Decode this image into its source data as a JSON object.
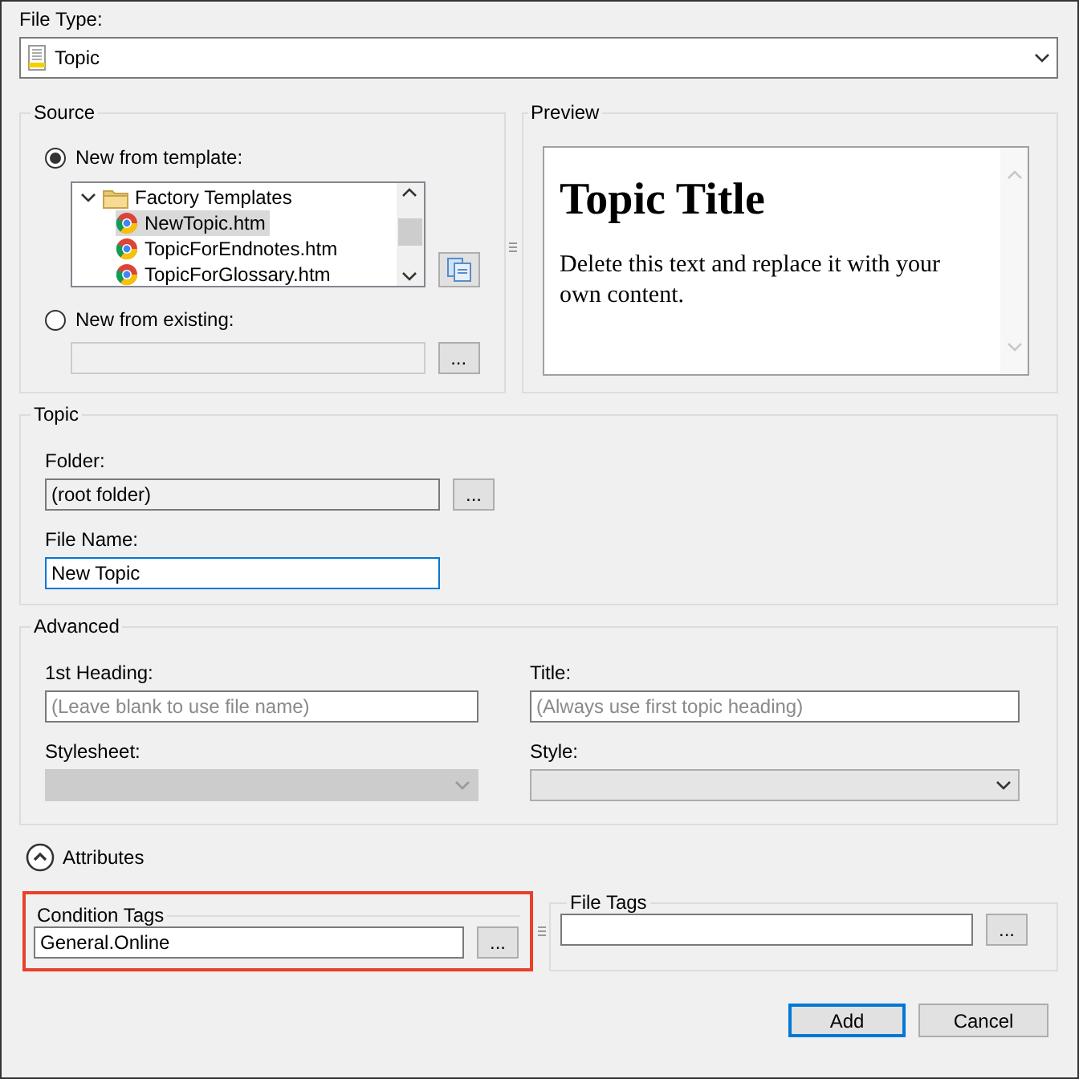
{
  "file_type": {
    "label": "File Type:",
    "value": "Topic"
  },
  "source": {
    "title": "Source",
    "options": [
      {
        "label": "New from template:",
        "selected": true
      },
      {
        "label": "New from existing:",
        "selected": false
      }
    ],
    "tree": [
      {
        "label": "Factory Templates",
        "kind": "folder",
        "expanded": true,
        "selected": false,
        "children": [
          {
            "label": "NewTopic.htm",
            "kind": "file",
            "selected": true
          },
          {
            "label": "TopicForEndnotes.htm",
            "kind": "file",
            "selected": false
          },
          {
            "label": "TopicForGlossary.htm",
            "kind": "file",
            "selected": false
          }
        ]
      }
    ],
    "existing_browse": "..."
  },
  "preview": {
    "title": "Preview",
    "heading": "Topic Title",
    "body": "Delete this text and replace it with your own content."
  },
  "topic": {
    "title": "Topic",
    "folder": {
      "label": "Folder:",
      "value": "(root folder)",
      "browse": "..."
    },
    "file_name": {
      "label": "File Name:",
      "value": "New Topic",
      "focused": true
    }
  },
  "advanced": {
    "title": "Advanced",
    "fields": [
      {
        "label": "1st Heading:",
        "kind": "text",
        "placeholder": "(Leave blank to use file name)"
      },
      {
        "label": "Title:",
        "kind": "text",
        "placeholder": "(Always use first topic heading)"
      },
      {
        "label": "Stylesheet:",
        "kind": "select",
        "disabled": true
      },
      {
        "label": "Style:",
        "kind": "select",
        "disabled": false
      }
    ]
  },
  "attributes": {
    "label": "Attributes",
    "expanded": true,
    "condition_tags": {
      "title": "Condition Tags",
      "value": "General.Online",
      "browse": "...",
      "highlighted": true
    },
    "file_tags": {
      "title": "File Tags",
      "browse": "..."
    }
  },
  "buttons": [
    {
      "label": "Add",
      "default": true
    },
    {
      "label": "Cancel",
      "default": false
    }
  ]
}
